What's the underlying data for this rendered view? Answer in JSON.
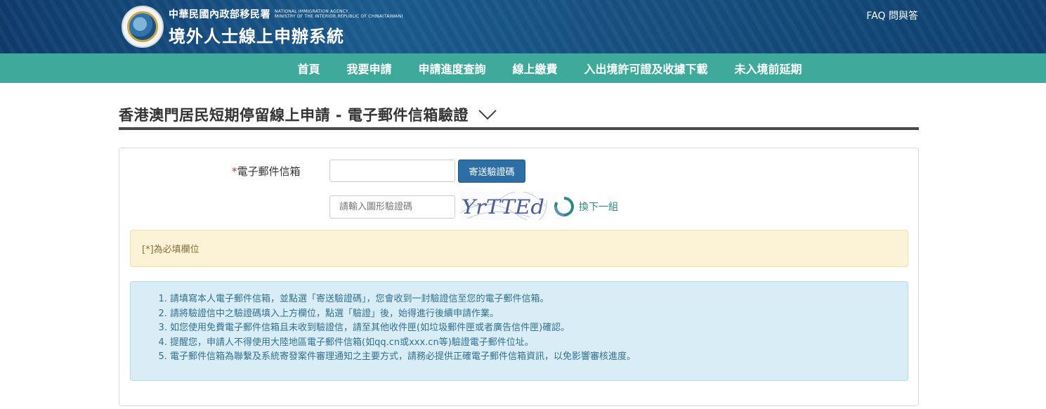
{
  "header": {
    "agency_zh": "中華民國內政部移民署",
    "agency_en_line1": "NATIONAL IMMIGRATION AGENCY,",
    "agency_en_line2": "MINISTRY OF THE INTERIOR,REPUBLIC OF CHINA(TAIWAN)",
    "system_name": "境外人士線上申辦系統",
    "faq_label": "FAQ 問與答"
  },
  "nav": {
    "items": [
      {
        "label": "首頁"
      },
      {
        "label": "我要申請"
      },
      {
        "label": "申請進度查詢"
      },
      {
        "label": "線上繳費"
      },
      {
        "label": "入出境許可證及收據下載"
      },
      {
        "label": "未入境前延期"
      }
    ]
  },
  "page": {
    "title": "香港澳門居民短期停留線上申請 - 電子郵件信箱驗證"
  },
  "form": {
    "required_mark": "*",
    "email_label": "電子郵件信箱",
    "email_value": "",
    "send_button_label": "寄送驗證碼",
    "captcha_placeholder": "請輸入圖形驗證碼",
    "captcha_text": "YrTTEd",
    "refresh_label": "換下一組"
  },
  "notices": {
    "required_note": "[*]為必填欄位",
    "instructions": [
      "請填寫本人電子郵件信箱，並點選「寄送驗證碼」，您會收到一封驗證信至您的電子郵件信箱。",
      "請將驗證信中之驗證碼填入上方欄位，點選「驗證」後，始得進行後續申請作業。",
      "如您使用免費電子郵件信箱且未收到驗證信，請至其他收件匣(如垃圾郵件匣或者廣告信件匣)確認。",
      "提醒您，申請人不得使用大陸地區電子郵件信箱(如qq.cn或xxx.cn等)驗證電子郵件位址。",
      "電子郵件信箱為聯繫及系統寄發案件審理通知之主要方式，請務必提供正確電子郵件信箱資訊，以免影響審核進度。"
    ]
  },
  "colors": {
    "nav_bg": "#3fa99c",
    "button_bg": "#2d6ea5",
    "warning_bg": "#fcf3d7",
    "info_bg": "#d9edf7"
  }
}
